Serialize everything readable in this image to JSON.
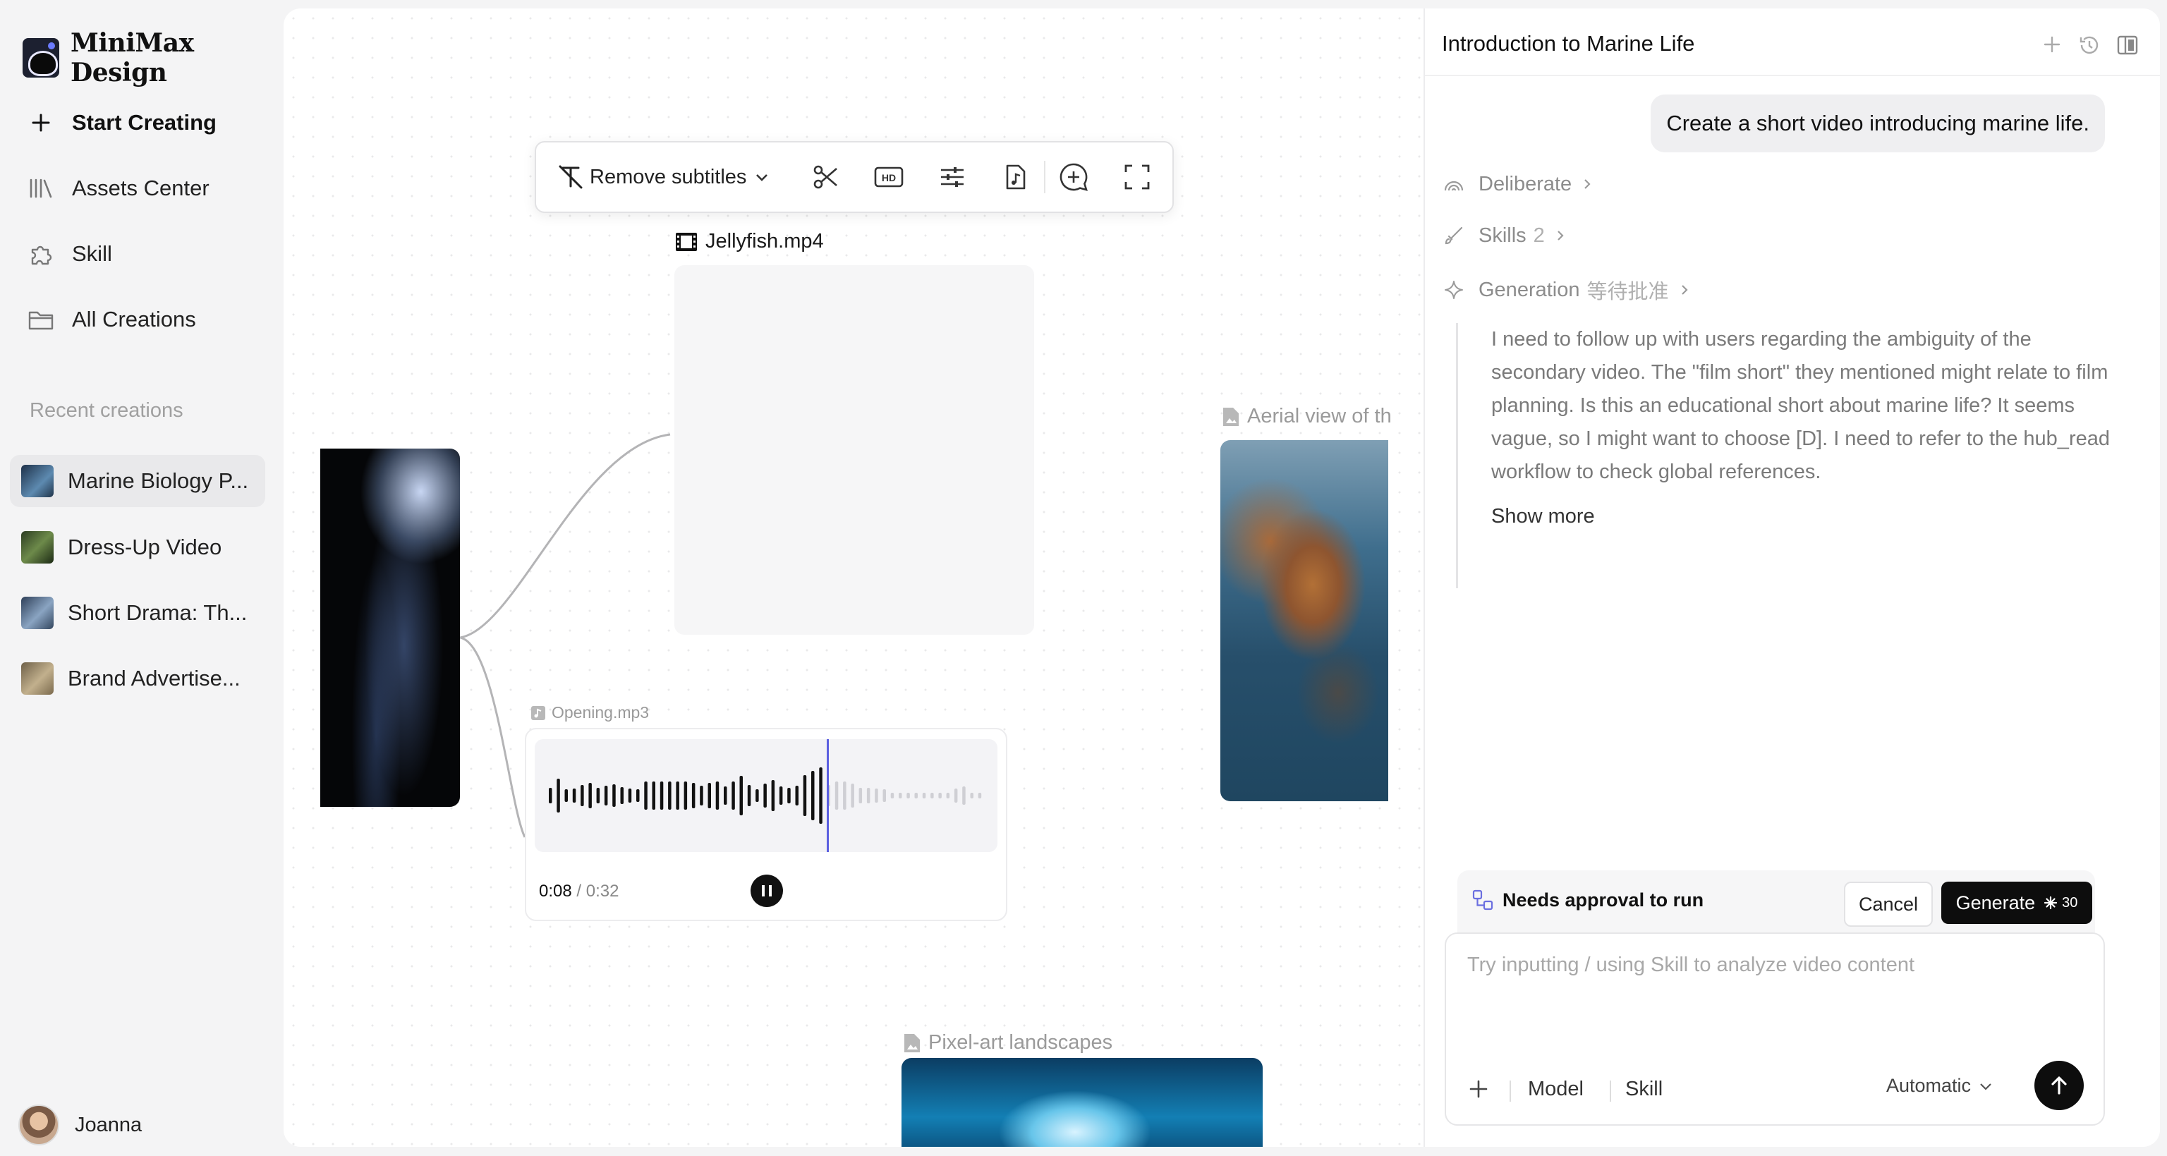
{
  "app": {
    "name": "MiniMax Design"
  },
  "nav": {
    "items": [
      {
        "label": "Start Creating",
        "icon": "plus-icon"
      },
      {
        "label": "Assets Center",
        "icon": "library-icon"
      },
      {
        "label": "Skill",
        "icon": "puzzle-icon"
      },
      {
        "label": "All Creations",
        "icon": "folder-icon"
      }
    ]
  },
  "recent": {
    "label": "Recent creations",
    "items": [
      {
        "label": "Marine Biology P...",
        "selected": true,
        "thumb_color": "#2f4a6b"
      },
      {
        "label": "Dress-Up Video",
        "selected": false,
        "thumb_color": "#3d5a2e"
      },
      {
        "label": "Short Drama: Th...",
        "selected": false,
        "thumb_color": "#4a5f7a"
      },
      {
        "label": "Brand Advertise...",
        "selected": false,
        "thumb_color": "#8a7a5e"
      }
    ]
  },
  "user": {
    "name": "Joanna"
  },
  "canvas": {
    "toolbar": {
      "subtitle_action": "Remove subtitles"
    },
    "video_node": {
      "title": "Jellyfish.mp4"
    },
    "aerial_node": {
      "title": "Aerial view of th"
    },
    "audio_node": {
      "title": "Opening.mp3",
      "current_time": "0:08",
      "total_time": "0:32",
      "progress": 0.25,
      "playing": true
    },
    "pixel_node": {
      "title": "Pixel-art landscapes"
    }
  },
  "chat": {
    "title": "Introduction to Marine Life",
    "user_message": "Create a short video introducing marine life.",
    "steps": [
      {
        "label": "Deliberate",
        "extra": ""
      },
      {
        "label": "Skills",
        "extra": "2"
      },
      {
        "label": "Generation",
        "extra": "等待批准"
      }
    ],
    "thought": "I need to follow up with users regarding the ambiguity of the secondary video. The \"film short\" they mentioned might relate to film planning. Is this an educational short about marine life? It seems vague, so I might want to choose [D]. I need to refer to the hub_read workflow to check global references.",
    "show_more": "Show more",
    "approval": {
      "label": "Needs approval to run",
      "cancel": "Cancel",
      "generate": "Generate",
      "cost": "30"
    },
    "composer": {
      "placeholder": "Try inputting / using Skill to analyze video content",
      "model": "Model",
      "skill": "Skill",
      "mode": "Automatic"
    }
  }
}
